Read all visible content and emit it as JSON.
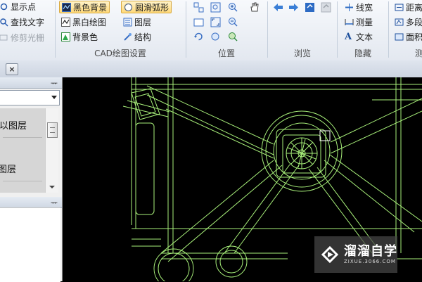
{
  "ribbon": {
    "left_group": {
      "show_points": "显示点",
      "find_text": "查找文字",
      "trim_raster": "修剪光栅"
    },
    "cad_settings": {
      "label": "CAD绘图设置",
      "black_bg": "黑色背景",
      "smooth_arc": "圆滑弧形",
      "bw_drawing": "黑白绘图",
      "layers": "图层",
      "background_color": "背景色",
      "structure": "结构"
    },
    "position": {
      "label": "位置"
    },
    "browse": {
      "label": "浏览"
    },
    "hide": {
      "label": "隐藏",
      "line_width": "线宽",
      "measure": "测量",
      "text": "文本"
    },
    "right_group": {
      "distance": "距离",
      "multi": "多段",
      "area": "面积",
      "label": "测"
    }
  },
  "tabs": {
    "close": "×"
  },
  "layer_panel": {
    "pin": "ᅲ",
    "items": [
      "以图层",
      "图层"
    ]
  },
  "watermark": {
    "title": "溜溜自学",
    "url": "ZIXUE.3066.COM"
  },
  "colors": {
    "drawing_line": "#a8f07a",
    "canvas": "#000000",
    "selected": "#ffd97a"
  }
}
